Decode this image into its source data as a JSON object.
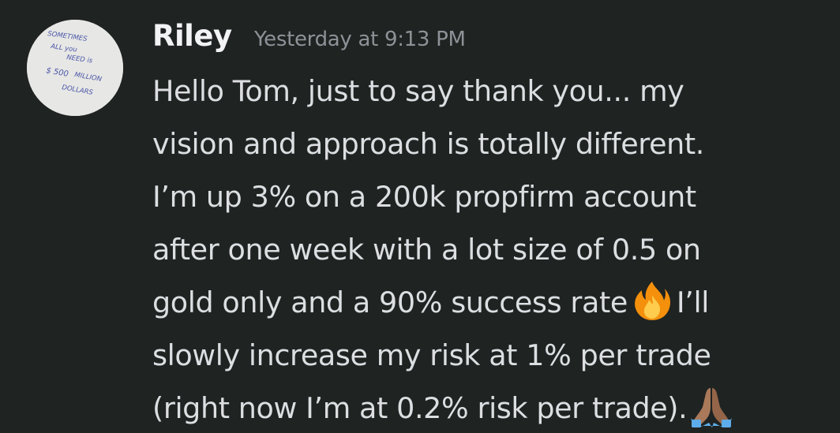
{
  "avatar": {
    "handwritten_text": [
      "SOMETIMES",
      "ALL YOU",
      "NEED IS",
      "$500 MILLION",
      "DOLLARS"
    ]
  },
  "message": {
    "author": "Riley",
    "timestamp": "Yesterday at 9:13 PM",
    "lines": [
      "Hello Tom, just to say thank you... my",
      "vision and approach is totally different.",
      "I’m up 3% on a 200k propfirm account",
      "after one week with a lot size of 0.5 on",
      "gold only and a 90% success rate",
      "I’ll",
      "slowly increase my risk at 1% per trade",
      "(right now I’m at 0.2% risk per trade)."
    ],
    "emojis": [
      "fire-emoji",
      "praying-hands-emoji"
    ]
  },
  "colors": {
    "background": "#1f2322",
    "username": "#f2f3f5",
    "timestamp": "#8d9297",
    "text": "#dcdee1"
  }
}
